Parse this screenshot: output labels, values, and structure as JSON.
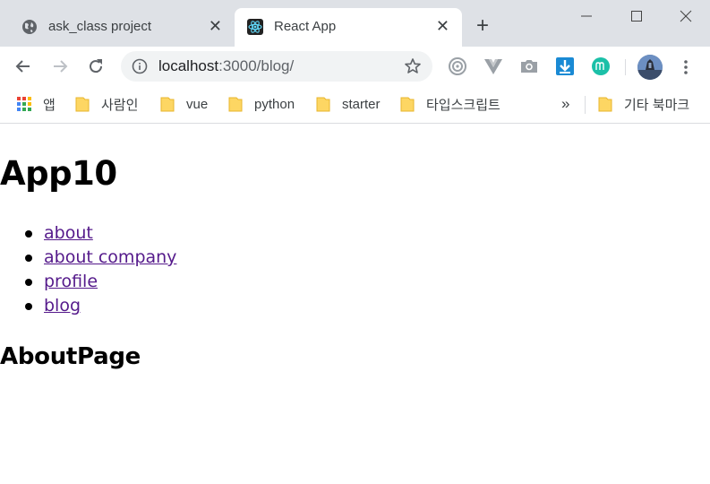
{
  "browser": {
    "tabs": [
      {
        "title": "ask_class project",
        "icon": "globe-icon",
        "active": false
      },
      {
        "title": "React App",
        "icon": "react-icon",
        "active": true
      }
    ],
    "address": {
      "host": "localhost",
      "path": ":3000/blog/"
    },
    "bookmarks": [
      {
        "label": "앱",
        "icon": "apps-grid-icon"
      },
      {
        "label": "사람인",
        "icon": "folder-icon"
      },
      {
        "label": "vue",
        "icon": "folder-icon"
      },
      {
        "label": "python",
        "icon": "folder-icon"
      },
      {
        "label": "starter",
        "icon": "folder-icon"
      },
      {
        "label": "타입스크립트",
        "icon": "folder-icon"
      }
    ],
    "bookmarks_overflow": "»",
    "other_bookmarks": "기타 북마크"
  },
  "page": {
    "heading": "App10",
    "links": [
      "about",
      "about company",
      "profile",
      "blog"
    ],
    "subheading": "AboutPage"
  },
  "colors": {
    "tabstrip": "#dee1e6",
    "visited_link": "#551a8b",
    "folder": "#fdd663"
  }
}
